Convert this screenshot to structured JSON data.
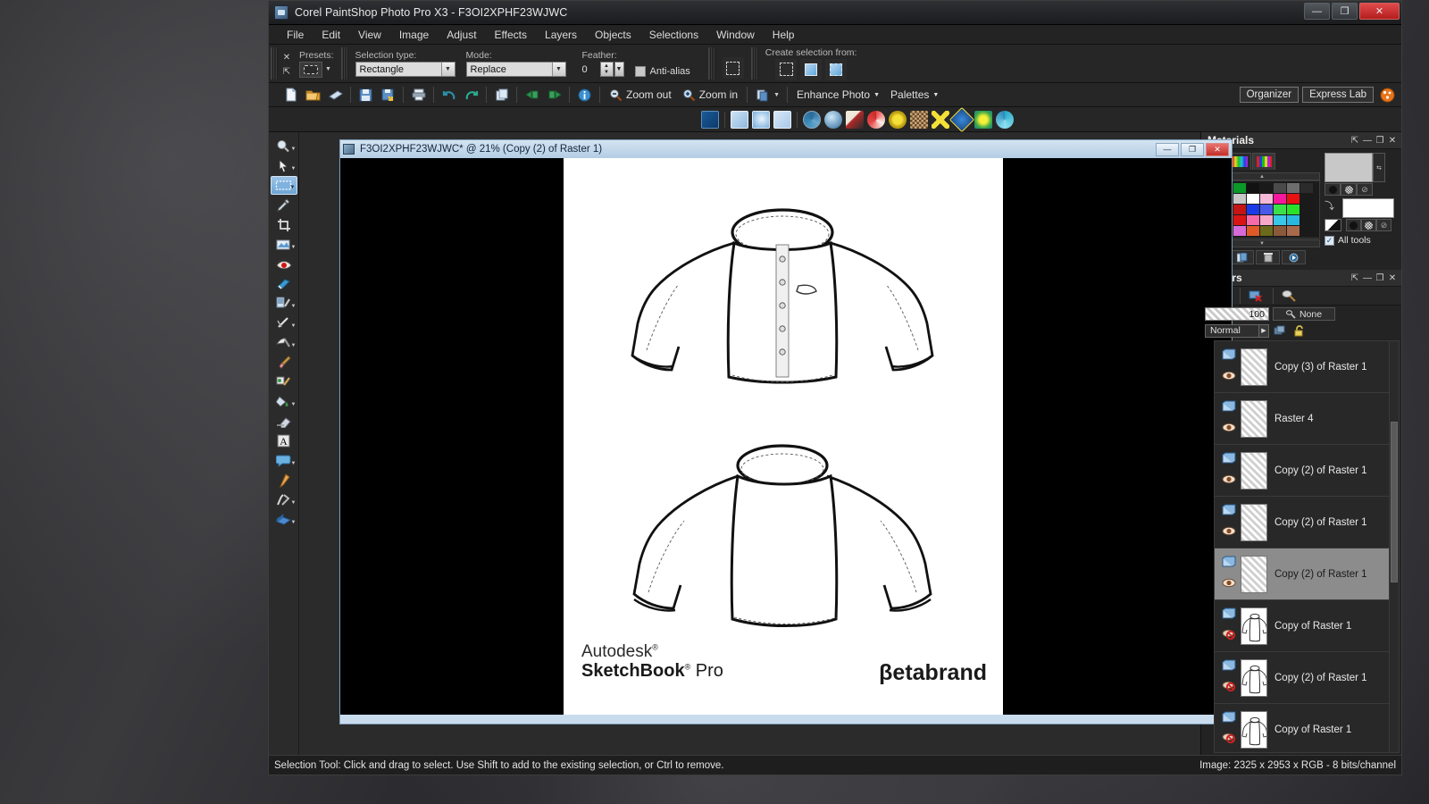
{
  "window": {
    "title": "Corel PaintShop Photo Pro X3 - F3OI2XPHF23WJWC",
    "minimize": "—",
    "maximize": "❐",
    "close": "✕"
  },
  "menubar": {
    "items": [
      {
        "label": "File"
      },
      {
        "label": "Edit"
      },
      {
        "label": "View"
      },
      {
        "label": "Image"
      },
      {
        "label": "Adjust"
      },
      {
        "label": "Effects"
      },
      {
        "label": "Layers"
      },
      {
        "label": "Objects"
      },
      {
        "label": "Selections"
      },
      {
        "label": "Window"
      },
      {
        "label": "Help"
      }
    ]
  },
  "options_bar": {
    "close_glyph": "✕",
    "pin_glyph": "⇱",
    "presets_label": "Presets:",
    "selection_type_label": "Selection type:",
    "selection_type_value": "Rectangle",
    "mode_label": "Mode:",
    "mode_value": "Replace",
    "feather_label": "Feather:",
    "feather_value": "0",
    "antialias_label": "Anti-alias",
    "antialias_checked": true,
    "create_selection_label": "Create selection from:"
  },
  "toolbar": {
    "icons": [
      {
        "name": "new-file-icon"
      },
      {
        "name": "open-folder-icon"
      },
      {
        "name": "browse-icon"
      },
      {
        "name": "save-icon"
      },
      {
        "name": "save-as-icon"
      },
      {
        "name": "print-icon"
      },
      {
        "name": "undo-icon"
      },
      {
        "name": "redo-icon"
      },
      {
        "name": "duplicate-icon"
      },
      {
        "name": "revert-icon"
      },
      {
        "name": "flip-icon"
      },
      {
        "name": "info-icon"
      }
    ],
    "zoom_out": "Zoom out",
    "zoom_in": "Zoom in",
    "enhance_photo": "Enhance Photo",
    "palettes": "Palettes",
    "organizer": "Organizer",
    "express_lab": "Express Lab"
  },
  "effects_bar": {
    "count": 13
  },
  "tool_palette": {
    "tools": [
      {
        "name": "zoom-tool",
        "has_arrow": true
      },
      {
        "name": "pan-pick-tool",
        "has_arrow": true
      },
      {
        "name": "selection-tool",
        "has_arrow": true,
        "active": true
      },
      {
        "name": "dropper-tool",
        "has_arrow": false
      },
      {
        "name": "crop-tool",
        "has_arrow": false
      },
      {
        "name": "straighten-tool",
        "has_arrow": true
      },
      {
        "name": "red-eye-tool",
        "has_arrow": false
      },
      {
        "name": "makeover-tool",
        "has_arrow": false
      },
      {
        "name": "clone-tool",
        "has_arrow": true
      },
      {
        "name": "scratch-remover-tool",
        "has_arrow": true
      },
      {
        "name": "dodge-burn-tool",
        "has_arrow": true
      },
      {
        "name": "paint-brush-tool",
        "has_arrow": false
      },
      {
        "name": "art-media-tool",
        "has_arrow": false
      },
      {
        "name": "flood-fill-tool",
        "has_arrow": true
      },
      {
        "name": "eraser-tool",
        "has_arrow": false
      },
      {
        "name": "text-tool",
        "has_arrow": false
      },
      {
        "name": "preset-shape-tool",
        "has_arrow": true
      },
      {
        "name": "pen-tool",
        "has_arrow": false
      },
      {
        "name": "warp-brush-tool",
        "has_arrow": true
      },
      {
        "name": "mesh-warp-tool",
        "has_arrow": true
      }
    ]
  },
  "document": {
    "title": "F3OI2XPHF23WJWC* @  21% (Copy (2) of Raster 1)",
    "minimize": "—",
    "maximize": "❐",
    "close": "✕",
    "artwork": {
      "autodesk_line1": "Autodesk",
      "autodesk_reg1": "®",
      "autodesk_line2": "SketchBook",
      "autodesk_reg2": "®",
      "autodesk_line3": "Pro",
      "betabrand": "βetabrand"
    }
  },
  "materials_panel": {
    "title": "Materials",
    "pin_glyph": "⇱",
    "minimize_glyph": "—",
    "maximize_glyph": "❐",
    "close_glyph": "✕",
    "tabs": [
      {
        "name": "frame-tab"
      },
      {
        "name": "rainbow-tab"
      },
      {
        "name": "swatches-tab",
        "selected": true
      }
    ],
    "swatch_colors": [
      "#0a2fb4",
      "#1ad8e8",
      "#0a9a2a",
      "#121212",
      "#1a1a1a",
      "#4a4a4a",
      "#6e6e6e",
      "#2b2b2b",
      "#8a8a8a",
      "#9a9a9a",
      "#c8c8c8",
      "#ffffff",
      "#f5b9d8",
      "#f5189c",
      "#e81212",
      "#1a1a1a",
      "#f59a0a",
      "#2a6a2a",
      "#c41414",
      "#1a3ae8",
      "#4a5ae8",
      "#3ae04a",
      "#2ae028",
      "#1a1a1a",
      "#f5d40a",
      "#f5e04a",
      "#d81414",
      "#f56aa8",
      "#f5a8c8",
      "#3ac8e8",
      "#2ab8e0",
      "#1a1a1a",
      "#2a9ae8",
      "#e88a2a",
      "#d86ad8",
      "#e05a28",
      "#6a6a1a",
      "#8a5a3a",
      "#a86a4a",
      "#1a1a1a"
    ],
    "all_tools_label": "All tools",
    "all_tools_checked": true
  },
  "layers_panel": {
    "title": "Layers",
    "pin_glyph": "⇱",
    "minimize_glyph": "—",
    "maximize_glyph": "❐",
    "close_glyph": "✕",
    "opacity": "100",
    "blend_ranges": "None",
    "blend_mode": "Normal",
    "layers": [
      {
        "name": "Copy (3) of Raster 1",
        "visible": true,
        "selected": false,
        "thumb": "empty"
      },
      {
        "name": "Raster 4",
        "visible": true,
        "selected": false,
        "thumb": "empty"
      },
      {
        "name": "Copy (2) of Raster 1",
        "visible": true,
        "selected": false,
        "thumb": "empty"
      },
      {
        "name": "Copy (2) of Raster 1",
        "visible": true,
        "selected": false,
        "thumb": "empty"
      },
      {
        "name": "Copy (2) of Raster 1",
        "visible": true,
        "selected": true,
        "thumb": "empty"
      },
      {
        "name": "Copy of Raster 1",
        "visible": false,
        "selected": false,
        "thumb": "shirt"
      },
      {
        "name": "Copy (2) of Raster 1",
        "visible": false,
        "selected": false,
        "thumb": "shirt"
      },
      {
        "name": "Copy of Raster 1",
        "visible": false,
        "selected": false,
        "thumb": "shirt"
      }
    ]
  },
  "status_bar": {
    "message": "Selection Tool: Click and drag to select. Use Shift to add to the existing selection, or Ctrl to remove.",
    "image_info": "Image:  2325 x 2953 x RGB - 8 bits/channel"
  }
}
